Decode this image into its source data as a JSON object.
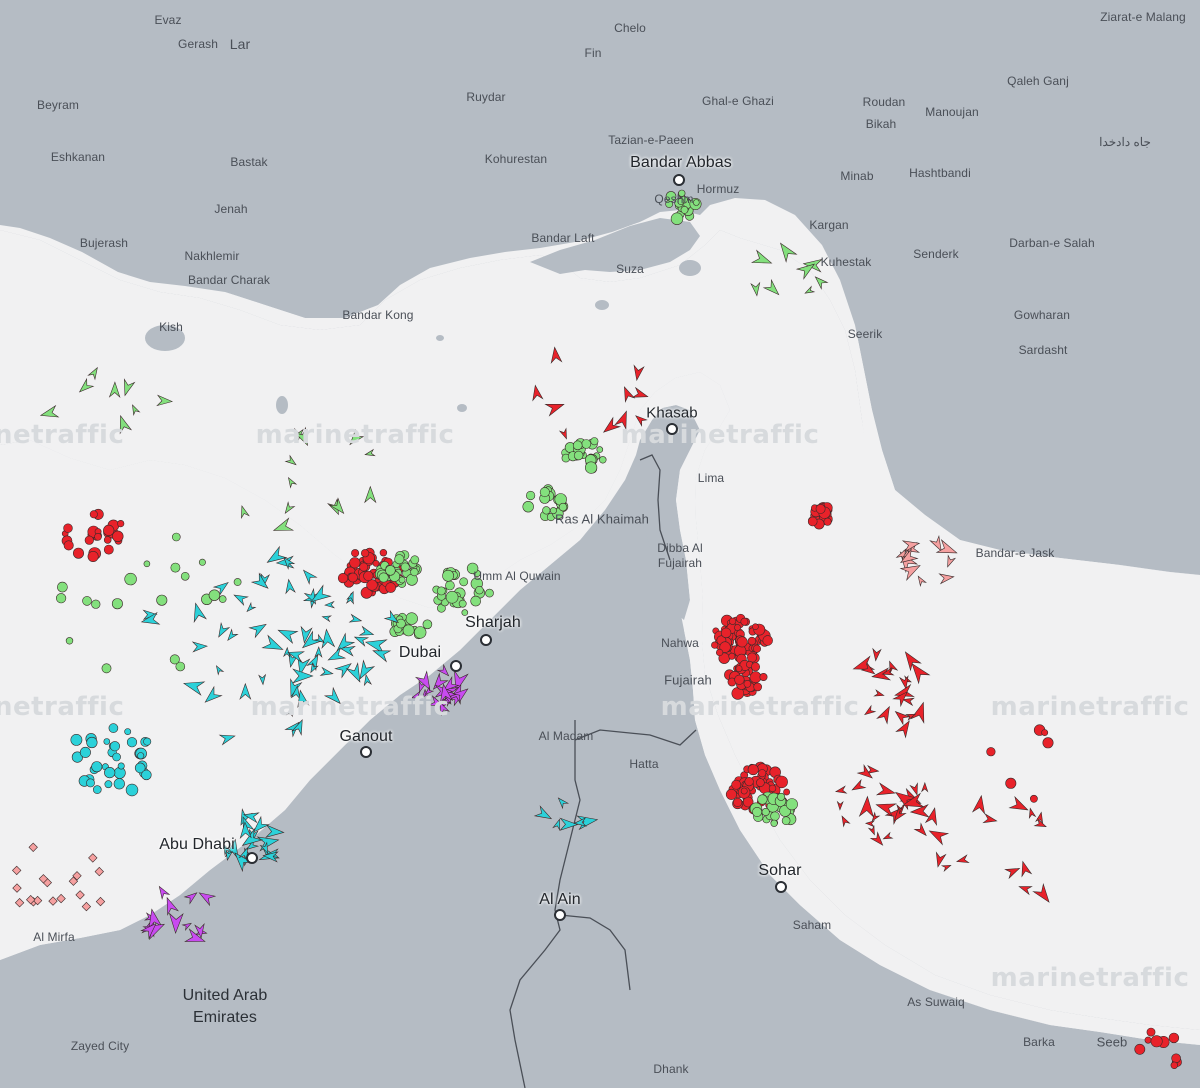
{
  "map": {
    "watermark_text": "marinetraffic",
    "colors": {
      "sea": "#b5bcc4",
      "land": "#f1f1f2",
      "border": "#4a4f57",
      "cargo": "#e8222a",
      "tanker": "#e8222a",
      "passenger": "#2bd1d9",
      "fishing": "#83e07d",
      "pleasure": "#c84bf0",
      "unknown": "#f5a0a0",
      "highspeed": "#f6d63a",
      "tug": "#2255ee"
    }
  },
  "labels": {
    "cities_major": [
      "Bandar Abbas",
      "Sharjah",
      "Dubai",
      "Ganout",
      "Abu Dhabi",
      "Sohar",
      "Al Ain",
      "Khasab"
    ],
    "cities": [
      "Evaz",
      "Gerash",
      "Lar",
      "Chelo",
      "Fin",
      "Ziarat-e Malang",
      "Qaleh Ganj",
      "Beyram",
      "Ruydar",
      "Ghal-e Ghazi",
      "Roudan",
      "Manoujan",
      "Bikah",
      "Tazian-e-Paeen",
      "Eshkanan",
      "Bastak",
      "Kohurestan",
      "Hormuz",
      "Minab",
      "Hashtbandi",
      "Jenah",
      "Qeshm",
      "Kargan",
      "Bujerash",
      "Nakhlemir",
      "Bandar Laft",
      "Senderk",
      "Darban-e Salah",
      "Kuhestak",
      "Bandar Charak",
      "Suza",
      "Kish",
      "Bandar Kong",
      "Seerik",
      "Gowharan",
      "Sardasht",
      "Lima",
      "Ras Al Khaimah",
      "Dibba Al Fujairah",
      "Umm Al Quwain",
      "Bandar-e Jask",
      "Nahwa",
      "Fujairah",
      "Al Madam",
      "Hatta",
      "Saham",
      "Al Mirfa",
      "As Suwaiq",
      "Barka",
      "Seeb",
      "Zayed City",
      "Dhank"
    ],
    "persian": "جاه دادخدا",
    "country_line1": "United Arab",
    "country_line2": "Emirates"
  }
}
